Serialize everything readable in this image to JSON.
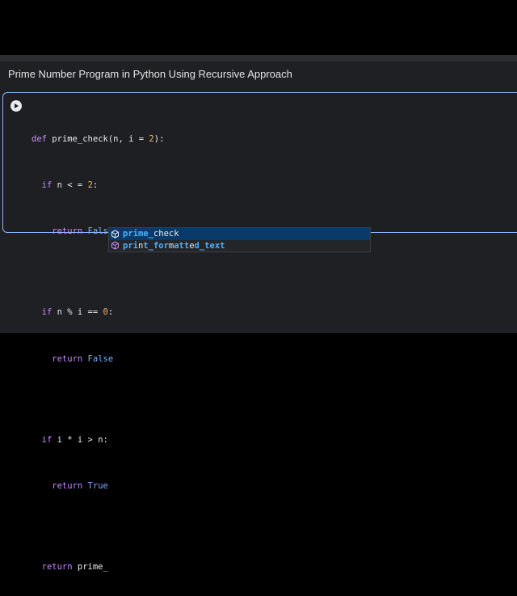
{
  "notebook": {
    "title": "Prime Number Program in Python Using Recursive Approach"
  },
  "code_lines": [
    [
      "def",
      " ",
      "prime_check",
      "(n, i = ",
      "2",
      "):"
    ],
    [
      "  if",
      " n < = ",
      "2",
      ":"
    ],
    [
      "    return",
      " ",
      "False"
    ],
    [],
    [
      "  if",
      " n % i == ",
      "0",
      ":"
    ],
    [
      "    return",
      " ",
      "False"
    ],
    [],
    [
      "  if",
      " i * i > n:"
    ],
    [
      "    return",
      " ",
      "True"
    ],
    [],
    [
      "  return",
      " prime_"
    ]
  ],
  "autocomplete": {
    "items": [
      {
        "parts": [
          "prime_",
          "check"
        ],
        "selected": true
      },
      {
        "parts": [
          "pri",
          "n",
          "t_for",
          "m",
          "att",
          "e",
          "d_text"
        ],
        "selected": false
      }
    ]
  },
  "colors": {
    "accent": "#8ab4f8",
    "keyword": "#c792ea",
    "number": "#f0b36a",
    "constant": "#7cacf8",
    "match": "#4fb0ff"
  }
}
